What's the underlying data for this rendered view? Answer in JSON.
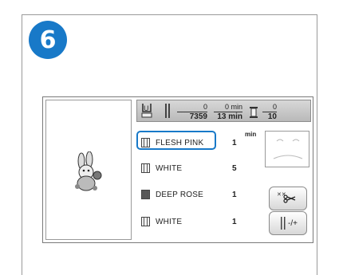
{
  "step": {
    "number": "6"
  },
  "status_bar": {
    "stitch_current": "0",
    "stitch_total": "7359",
    "time_current": "0 min",
    "time_total": "13 min",
    "color_current": "0",
    "color_total": "10"
  },
  "colors": [
    {
      "name": "FLESH PINK",
      "qty": "1",
      "qty_unit": "min",
      "selected": true
    },
    {
      "name": "WHITE",
      "qty": "5"
    },
    {
      "name": "DEEP ROSE",
      "qty": "1"
    },
    {
      "name": "WHITE",
      "qty": "1"
    }
  ],
  "buttons": {
    "cut": {
      "icon": "thread-cut-icon"
    },
    "tension": {
      "icon": "thread-tension-icon",
      "label": "-/+"
    }
  },
  "accent": "#1879c8"
}
